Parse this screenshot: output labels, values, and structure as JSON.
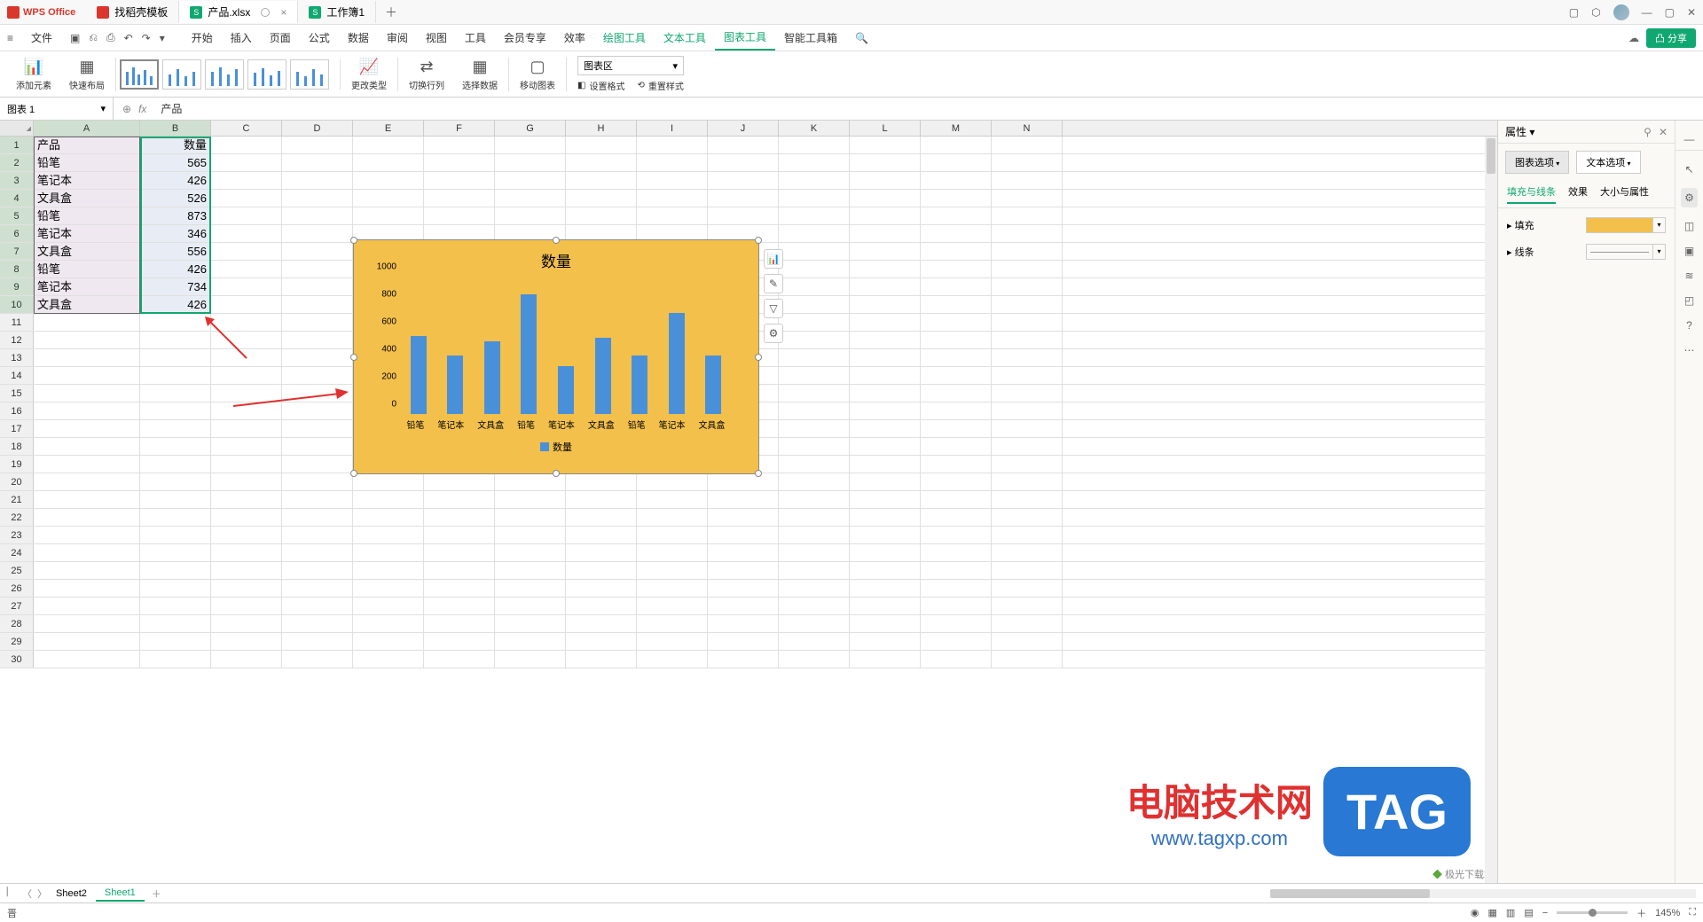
{
  "app": {
    "name": "WPS Office"
  },
  "tabs": [
    {
      "label": "找稻壳模板",
      "icon": "red"
    },
    {
      "label": "产品.xlsx",
      "icon": "green",
      "glyph": "S",
      "active": true
    },
    {
      "label": "工作簿1",
      "icon": "green",
      "glyph": "S"
    }
  ],
  "menu": {
    "file": "文件",
    "items": [
      "开始",
      "插入",
      "页面",
      "公式",
      "数据",
      "审阅",
      "视图",
      "工具",
      "会员专享",
      "效率"
    ],
    "green": [
      "绘图工具",
      "文本工具",
      "图表工具",
      "智能工具箱"
    ],
    "active": "图表工具",
    "share": "分享"
  },
  "ribbon": {
    "add_element": "添加元素",
    "quick_layout": "快速布局",
    "change_type": "更改类型",
    "swap_rc": "切换行列",
    "select_data": "选择数据",
    "move_chart": "移动图表",
    "chart_area": "图表区",
    "set_format": "设置格式",
    "reset_style": "重置样式"
  },
  "name_box": "图表 1",
  "formula_value": "产品",
  "columns": [
    "A",
    "B",
    "C",
    "D",
    "E",
    "F",
    "G",
    "H",
    "I",
    "J",
    "K",
    "L",
    "M",
    "N"
  ],
  "data": {
    "header": [
      "产品",
      "数量"
    ],
    "rows": [
      [
        "铅笔",
        "565"
      ],
      [
        "笔记本",
        "426"
      ],
      [
        "文具盒",
        "526"
      ],
      [
        "铅笔",
        "873"
      ],
      [
        "笔记本",
        "346"
      ],
      [
        "文具盒",
        "556"
      ],
      [
        "铅笔",
        "426"
      ],
      [
        "笔记本",
        "734"
      ],
      [
        "文具盒",
        "426"
      ]
    ]
  },
  "chart_data": {
    "type": "bar",
    "title": "数量",
    "categories": [
      "铅笔",
      "笔记本",
      "文具盒",
      "铅笔",
      "笔记本",
      "文具盒",
      "铅笔",
      "笔记本",
      "文具盒"
    ],
    "values": [
      565,
      426,
      526,
      873,
      346,
      556,
      426,
      734,
      426
    ],
    "y_ticks": [
      0,
      200,
      400,
      600,
      800,
      1000
    ],
    "ylim": [
      0,
      1000
    ],
    "legend": "数量"
  },
  "props": {
    "title": "属性",
    "tab_chart": "图表选项",
    "tab_text": "文本选项",
    "sub_fill": "填充与线条",
    "sub_effect": "效果",
    "sub_size": "大小与属性",
    "fill_label": "填充",
    "line_label": "线条"
  },
  "sheets": {
    "s1": "Sheet2",
    "s2": "Sheet1"
  },
  "status": {
    "mode": "晋",
    "zoom": "145%"
  },
  "watermark": {
    "title": "电脑技术网",
    "url": "www.tagxp.com",
    "tag": "TAG",
    "corner": "极光下载站"
  }
}
